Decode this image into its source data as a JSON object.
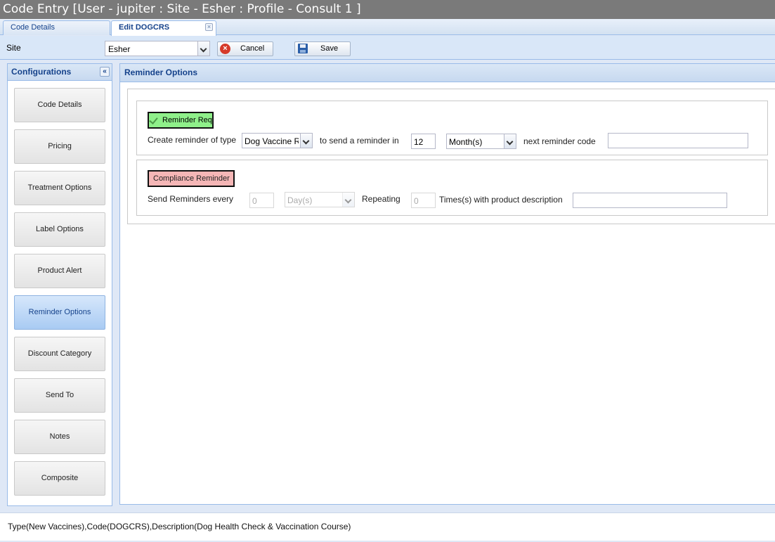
{
  "window": {
    "title": "Code Entry [User - jupiter : Site - Esher : Profile - Consult 1 ]"
  },
  "tabs": [
    {
      "label": "Code Details"
    },
    {
      "label": "Edit DOGCRS",
      "close": "×"
    }
  ],
  "toolbar": {
    "site_label": "Site",
    "site_value": "Esher",
    "cancel_label": "Cancel",
    "save_label": "Save"
  },
  "configurations": {
    "title": "Configurations",
    "collapse": "«",
    "items": [
      {
        "label": "Code Details"
      },
      {
        "label": "Pricing"
      },
      {
        "label": "Treatment Options"
      },
      {
        "label": "Label Options"
      },
      {
        "label": "Product Alert"
      },
      {
        "label": "Reminder Options",
        "active": true
      },
      {
        "label": "Discount Category"
      },
      {
        "label": "Send To"
      },
      {
        "label": "Notes"
      },
      {
        "label": "Composite"
      }
    ]
  },
  "reminder_options": {
    "title": "Reminder Options",
    "reminder": {
      "badge": "Reminder Req",
      "create_label": "Create reminder of type",
      "type_value": "Dog Vaccine R",
      "send_label": "to send a reminder in",
      "interval_value": "12",
      "unit_value": "Month(s)",
      "next_label": "next reminder code",
      "next_value": ""
    },
    "compliance": {
      "badge": "Compliance Reminder",
      "every_label": "Send Reminders every",
      "every_value": "0",
      "unit_value": "Day(s)",
      "repeating_label": "Repeating",
      "repeating_value": "0",
      "times_label": "Times(s) with product description",
      "description_value": ""
    }
  },
  "status": {
    "text": "Type(New Vaccines),Code(DOGCRS),Description(Dog Health Check & Vaccination Course)"
  },
  "colors": {
    "titlebar": "#7a7a7a",
    "header_text": "#15428b",
    "reminder_badge": "#8ff08a",
    "compliance_badge": "#f5b6b6",
    "active_config": "#a9cbf3"
  }
}
